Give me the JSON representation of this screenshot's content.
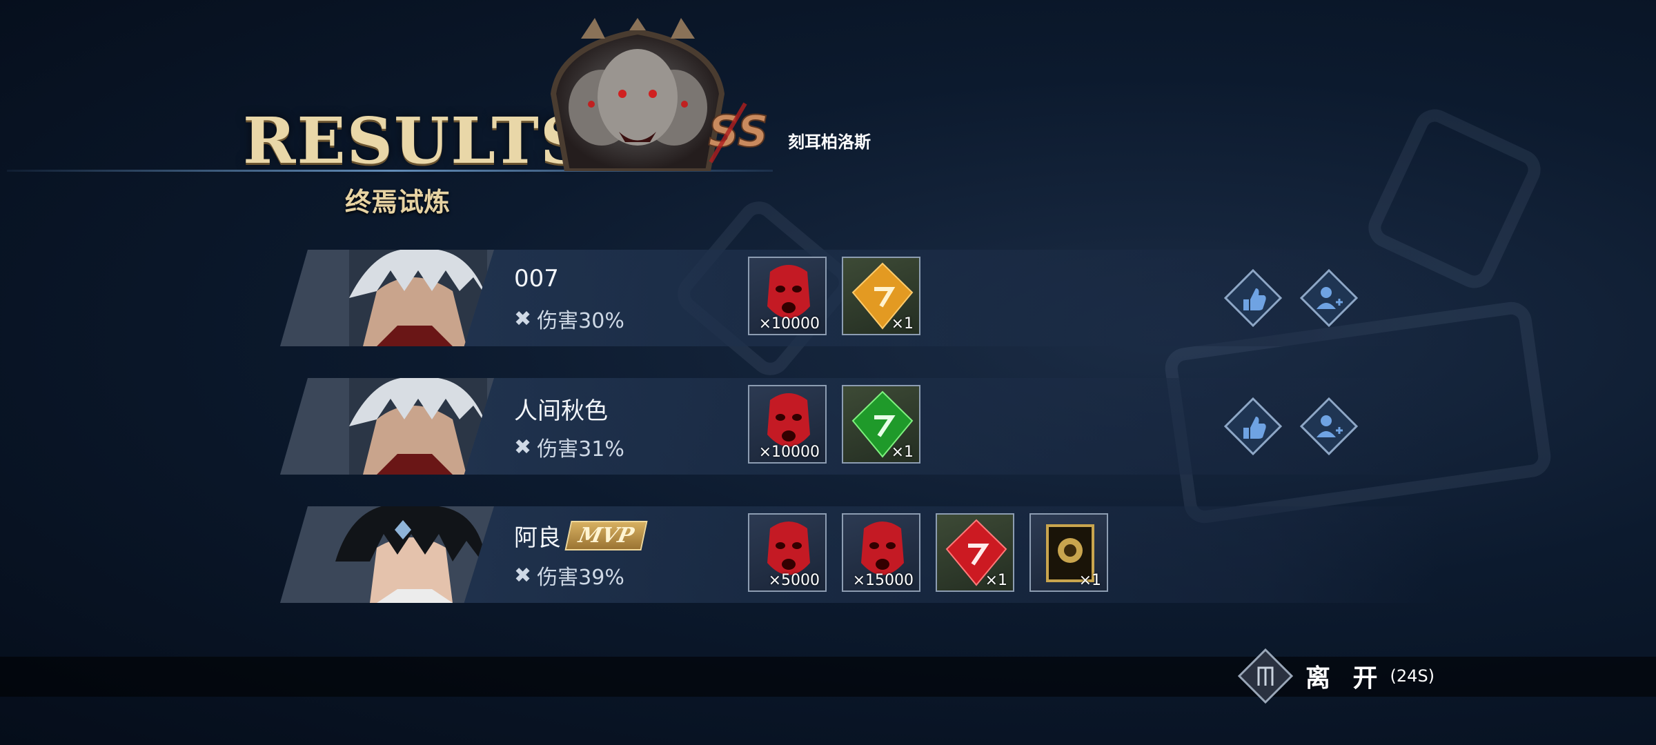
{
  "header": {
    "title": "RESULTS",
    "subtitle": "终焉试炼",
    "boss_name": "刻耳柏洛斯",
    "rank": "SS"
  },
  "players": [
    {
      "name": "007",
      "damage": "伤害30%",
      "mvp": false,
      "rewards": [
        {
          "icon": "red-mask-icon",
          "qty": "×10000"
        },
        {
          "icon": "orange-crystal-icon",
          "qty": "×1"
        }
      ],
      "actions": [
        "like-icon",
        "add-friend-icon"
      ]
    },
    {
      "name": "人间秋色",
      "damage": "伤害31%",
      "mvp": false,
      "rewards": [
        {
          "icon": "red-mask-icon",
          "qty": "×10000"
        },
        {
          "icon": "green-crystal-icon",
          "qty": "×1"
        }
      ],
      "actions": [
        "like-icon",
        "add-friend-icon"
      ]
    },
    {
      "name": "阿良",
      "damage": "伤害39%",
      "mvp": true,
      "mvp_label": "MVP",
      "rewards": [
        {
          "icon": "red-mask-icon",
          "qty": "×5000"
        },
        {
          "icon": "red-mask-icon",
          "qty": "×15000"
        },
        {
          "icon": "red-crystal-icon",
          "qty": "×1"
        },
        {
          "icon": "gold-card-icon",
          "qty": "×1"
        }
      ],
      "actions": []
    }
  ],
  "footer": {
    "leave_label": "离 开",
    "timer": "(24S)"
  },
  "colors": {
    "accent_gold": "#e9d7a8",
    "panel": "#1e304b",
    "item_border": "#8d9db2"
  }
}
